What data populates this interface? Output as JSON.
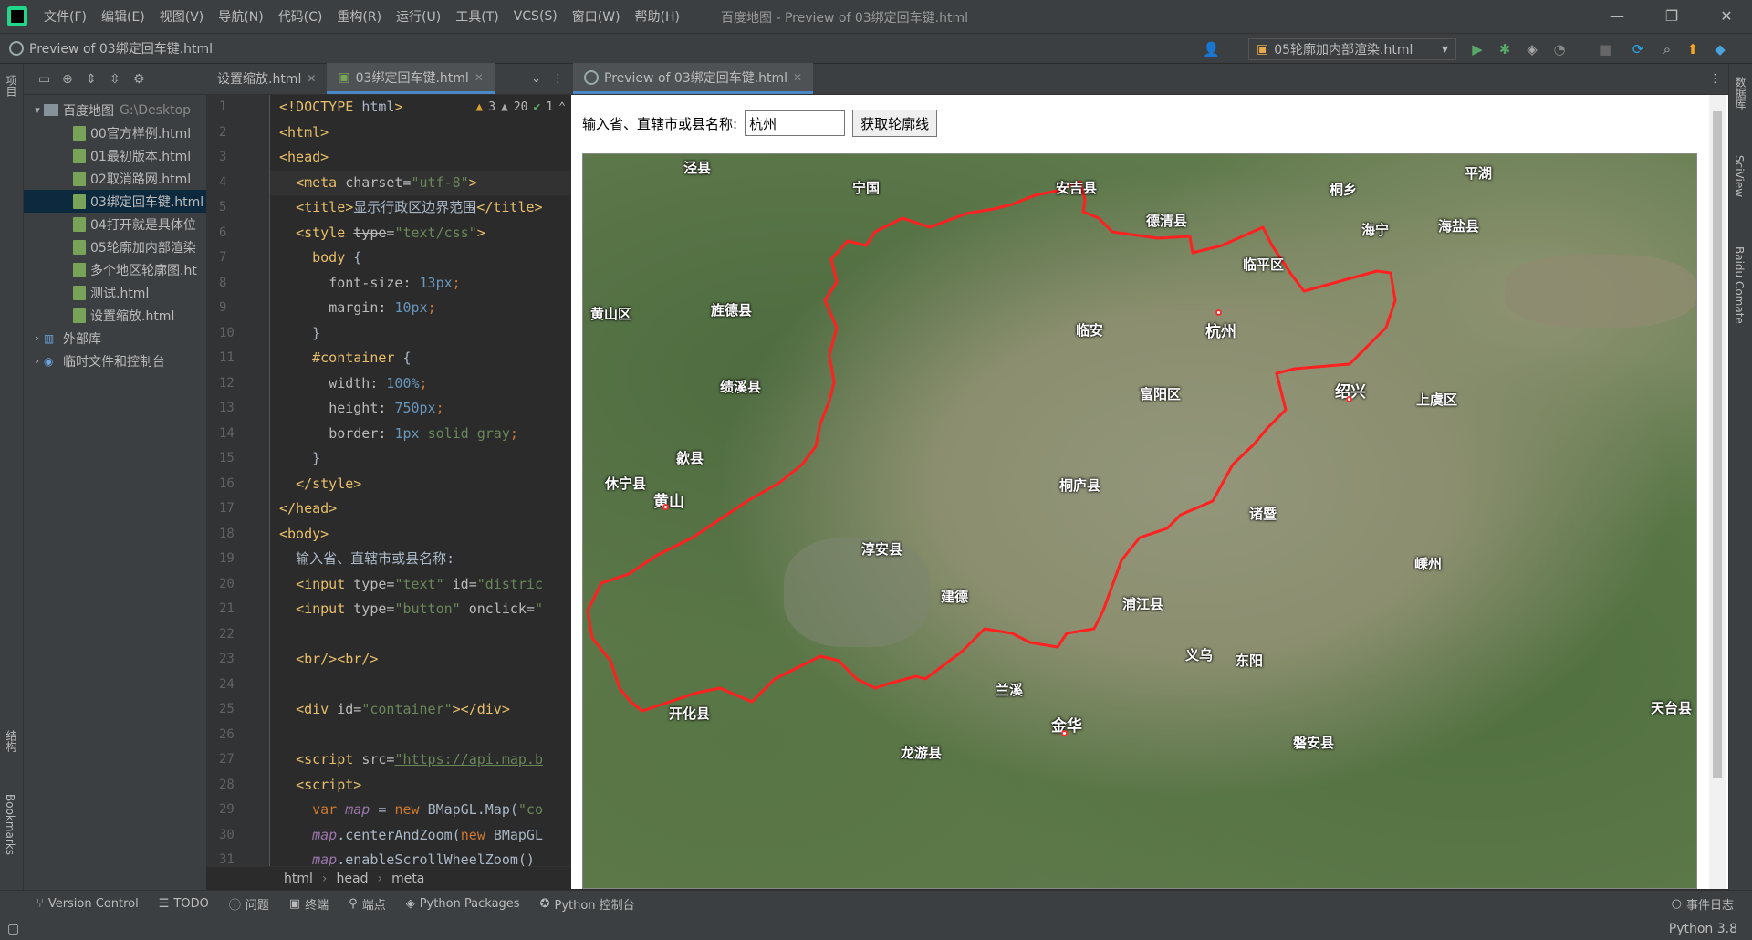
{
  "window": {
    "title": "百度地图 - Preview of 03绑定回车键.html"
  },
  "menu": [
    "文件(F)",
    "编辑(E)",
    "视图(V)",
    "导航(N)",
    "代码(C)",
    "重构(R)",
    "运行(U)",
    "工具(T)",
    "VCS(S)",
    "窗口(W)",
    "帮助(H)"
  ],
  "nav": {
    "breadcrumb": "Preview of 03绑定回车键.html",
    "run_config": "05轮廓加内部渲染.html"
  },
  "left_strip": {
    "project": "项目",
    "structure": "结构",
    "bookmarks": "Bookmarks"
  },
  "project": {
    "root": "百度地图",
    "root_path": "G:\\Desktop",
    "files": [
      "00官方样例.html",
      "01最初版本.html",
      "02取消路网.html",
      "03绑定回车键.html",
      "04打开就是具体位",
      "05轮廓加内部渲染",
      "多个地区轮廓图.ht",
      "测试.html",
      "设置缩放.html"
    ],
    "selected": "03绑定回车键.html",
    "ext_lib": "外部库",
    "scratch": "临时文件和控制台"
  },
  "editor": {
    "tabs": [
      "设置缩放.html",
      "03绑定回车键.html"
    ],
    "inspections": {
      "warn1": "3",
      "warn2": "20",
      "ok": "1"
    },
    "line_numbers": [
      "1",
      "2",
      "3",
      "4",
      "5",
      "6",
      "7",
      "8",
      "9",
      "10",
      "11",
      "12",
      "13",
      "14",
      "15",
      "16",
      "17",
      "18",
      "19",
      "20",
      "21",
      "22",
      "23",
      "24",
      "25",
      "26",
      "27",
      "28",
      "29",
      "30",
      "31"
    ],
    "breadcrumb": [
      "html",
      "head",
      "meta"
    ]
  },
  "code_text": {
    "l19": "输入省、直辖市或县名称:"
  },
  "preview": {
    "tab": "Preview of 03绑定回车键.html",
    "label": "输入省、直辖市或县名称:",
    "input_value": "杭州",
    "button": "获取轮廓线"
  },
  "map_labels": [
    "泾县",
    "宁国",
    "安吉县",
    "德清县",
    "桐乡",
    "平湖",
    "海宁",
    "海盐县",
    "临平区",
    "黄山区",
    "旌德县",
    "临安",
    "杭州",
    "绩溪县",
    "富阳区",
    "绍兴",
    "上虞区",
    "歙县",
    "休宁县",
    "黄山",
    "桐庐县",
    "诸暨",
    "嵊州",
    "淳安县",
    "建德",
    "浦江县",
    "义乌",
    "东阳",
    "兰溪",
    "开化县",
    "金华",
    "天台县",
    "磐安县",
    "龙游县"
  ],
  "right_strip": {
    "db": "数据库",
    "sciview": "SciView",
    "comate": "Baidu Comate"
  },
  "status": {
    "version_control": "Version Control",
    "todo": "TODO",
    "problems": "问题",
    "terminal": "终端",
    "endpoints": "端点",
    "packages": "Python Packages",
    "console": "Python 控制台",
    "event_log": "事件日志",
    "interpreter": "Python 3.8"
  },
  "colors": {
    "boundary": "#ff2020",
    "selection": "#0d293e",
    "accent": "#4a88c7"
  }
}
